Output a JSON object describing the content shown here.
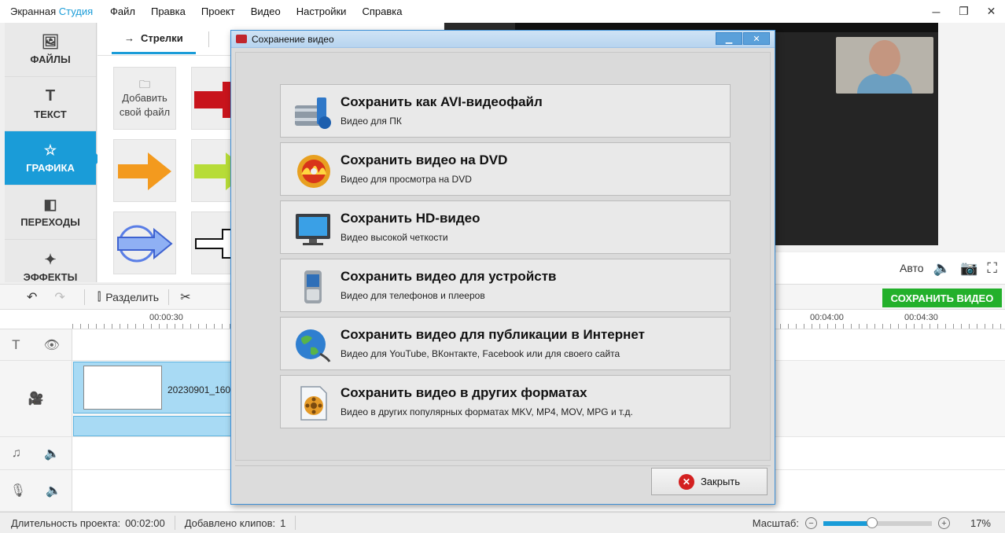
{
  "app": {
    "title_main": "Экранная",
    "title_accent": "Студия"
  },
  "menu": [
    "Файл",
    "Правка",
    "Проект",
    "Видео",
    "Настройки",
    "Справка"
  ],
  "sidebar": {
    "items": [
      {
        "label": "ФАЙЛЫ",
        "icon": "image-icon"
      },
      {
        "label": "ТЕКСТ",
        "icon": "text-icon"
      },
      {
        "label": "ГРАФИКА",
        "icon": "star-icon",
        "active": true
      },
      {
        "label": "ПЕРЕХОДЫ",
        "icon": "transitions-icon"
      },
      {
        "label": "ЭФФЕКТЫ",
        "icon": "magic-wand-icon"
      }
    ]
  },
  "graphics": {
    "tab": "Стрелки",
    "add_own": "Добавить свой файл"
  },
  "player": {
    "auto": "Авто"
  },
  "toolbar": {
    "split": "Разделить",
    "save_video": "СОХРАНИТЬ ВИДЕО"
  },
  "timeline": {
    "ticks": [
      "00:00:30",
      "00:04:00",
      "00:04:30"
    ],
    "clip_name": "20230901_160"
  },
  "status": {
    "duration_label": "Длительность проекта:",
    "duration_value": "00:02:00",
    "clips_label": "Добавлено клипов:",
    "clips_value": "1",
    "zoom_label": "Масштаб:",
    "zoom_value": "17%",
    "zoom_level": 0.45
  },
  "dialog": {
    "title": "Сохранение видео",
    "options": [
      {
        "title": "Сохранить как AVI-видеофайл",
        "subtitle": "Видео для ПК",
        "icon": "film-reel-icon"
      },
      {
        "title": "Сохранить видео на DVD",
        "subtitle": "Видео для просмотра на DVD",
        "icon": "dvd-disc-icon"
      },
      {
        "title": "Сохранить HD-видео",
        "subtitle": "Видео высокой четкости",
        "icon": "monitor-icon"
      },
      {
        "title": "Сохранить видео для устройств",
        "subtitle": "Видео для телефонов и плееров",
        "icon": "phone-icon"
      },
      {
        "title": "Сохранить видео для публикации в Интернет",
        "subtitle": "Видео для YouTube, ВКонтакте, Facebook или для своего сайта",
        "icon": "globe-icon"
      },
      {
        "title": "Сохранить видео в других форматах",
        "subtitle": "Видео в других популярных форматах MKV, MP4, MOV, MPG и т.д.",
        "icon": "file-reel-icon"
      }
    ],
    "close": "Закрыть"
  }
}
